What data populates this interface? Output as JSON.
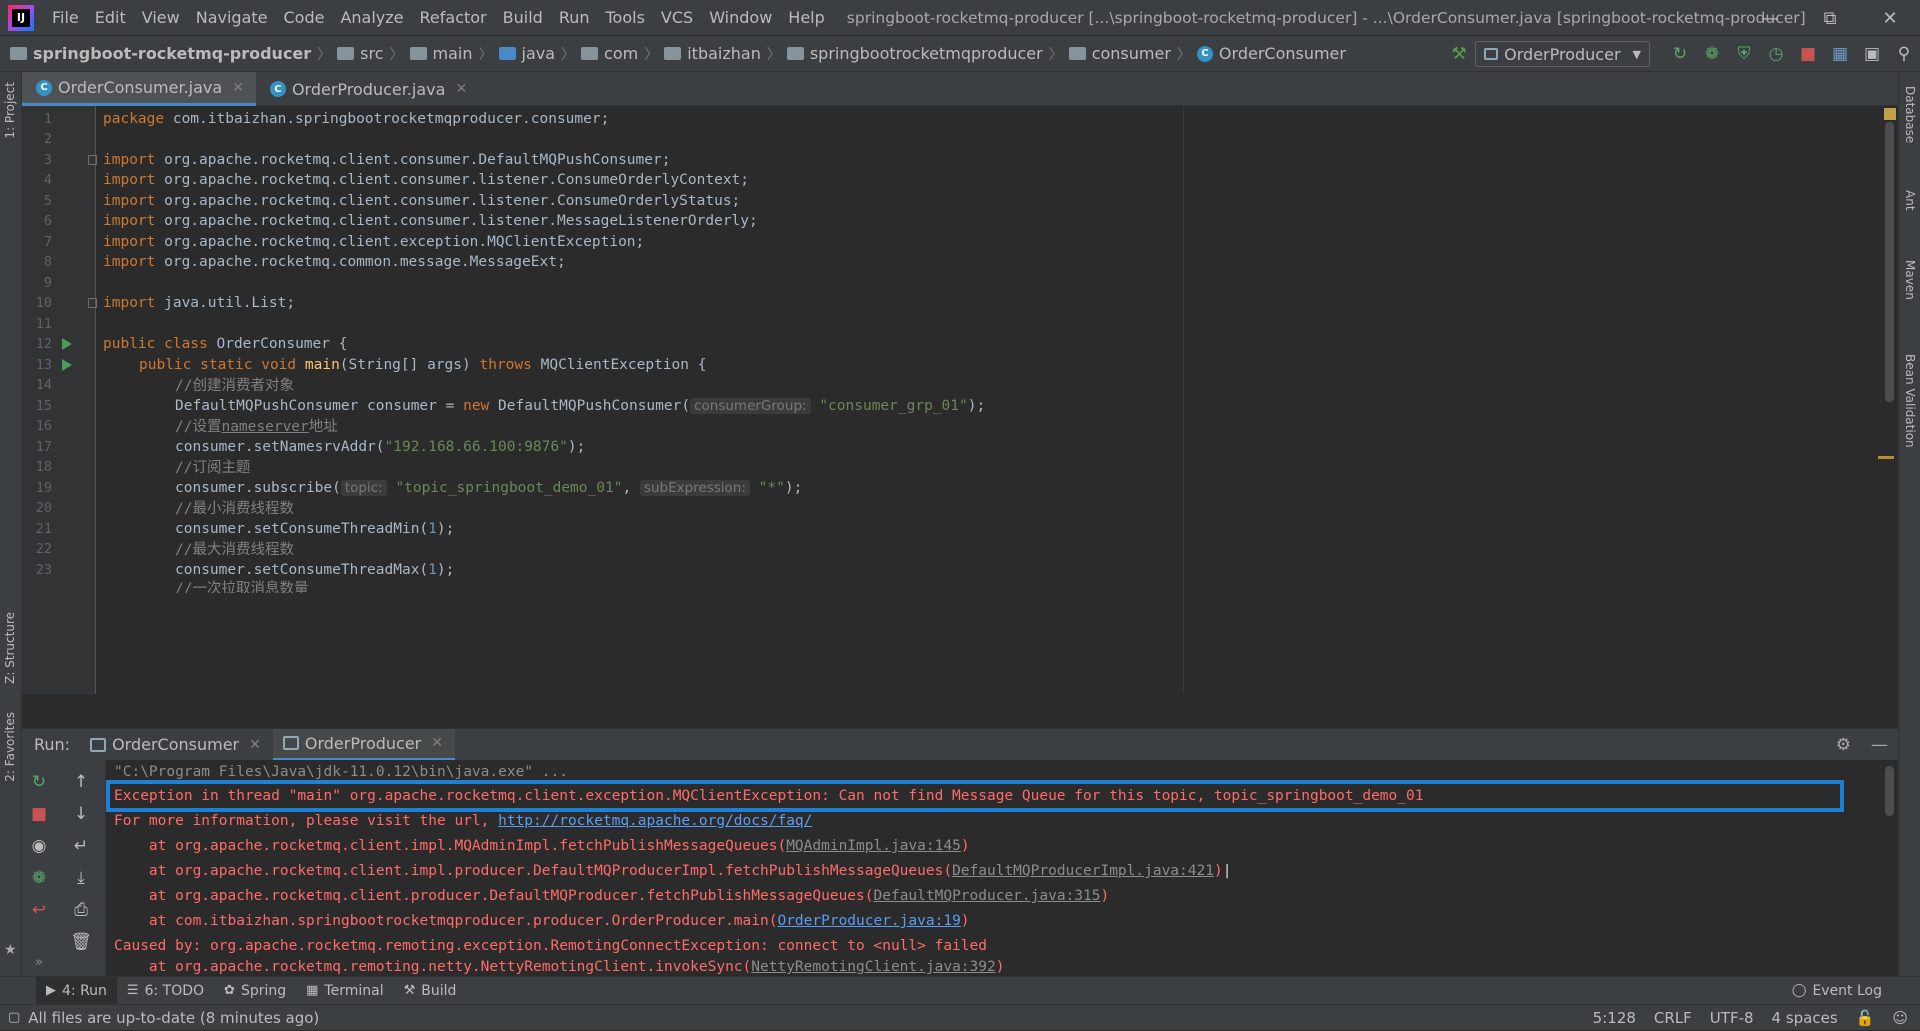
{
  "titlebar": {
    "menu": [
      "File",
      "Edit",
      "View",
      "Navigate",
      "Code",
      "Analyze",
      "Refactor",
      "Build",
      "Run",
      "Tools",
      "VCS",
      "Window",
      "Help"
    ],
    "window_title": "springboot-rocketmq-producer [...\\springboot-rocketmq-producer] - ...\\OrderConsumer.java [springboot-rocketmq-producer]"
  },
  "breadcrumb": {
    "project": "springboot-rocketmq-producer",
    "items": [
      "src",
      "main",
      "java",
      "com",
      "itbaizhan",
      "springbootrocketmqproducer",
      "consumer",
      "OrderConsumer"
    ]
  },
  "run_config": {
    "selected": "OrderProducer"
  },
  "left_stripe": {
    "project": "1: Project",
    "structure": "Z: Structure",
    "favorites": "2: Favorites"
  },
  "right_stripe": {
    "database": "Database",
    "ant": "Ant",
    "maven": "Maven",
    "bean": "Bean Validation"
  },
  "editor_tabs": [
    {
      "label": "OrderConsumer.java",
      "active": true
    },
    {
      "label": "OrderProducer.java",
      "active": false
    }
  ],
  "code": {
    "line_numbers": [
      "1",
      "2",
      "3",
      "4",
      "5",
      "6",
      "7",
      "8",
      "9",
      "10",
      "11",
      "12",
      "13",
      "14",
      "15",
      "16",
      "17",
      "18",
      "19",
      "20",
      "21",
      "22",
      "23"
    ],
    "l1_kw": "package",
    "l1_rest": " com.itbaizhan.springbootrocketmqproducer.consumer;",
    "import_kw": "import",
    "l3": " org.apache.rocketmq.client.consumer.DefaultMQPushConsumer;",
    "l4": " org.apache.rocketmq.client.consumer.listener.ConsumeOrderlyContext;",
    "l5": " org.apache.rocketmq.client.consumer.listener.ConsumeOrderlyStatus;",
    "l6": " org.apache.rocketmq.client.consumer.listener.MessageListenerOrderly;",
    "l7": " org.apache.rocketmq.client.exception.MQClientException;",
    "l8": " org.apache.rocketmq.common.message.MessageExt;",
    "l10": " java.util.List;",
    "l12_kw": "public class",
    "l12_rest": " OrderConsumer {",
    "l13_kw1": "public static void",
    "l13_fn": "main",
    "l13_mid": "(String[] args) ",
    "l13_kw2": "throws",
    "l13_rest": " MQClientException {",
    "l14": "//创建消费者对象",
    "l15_a": "DefaultMQPushConsumer consumer = ",
    "l15_kw": "new",
    "l15_b": " DefaultMQPushConsumer(",
    "l15_hint": "consumerGroup:",
    "l15_str": "\"consumer_grp_01\"",
    "l15_end": ");",
    "l16_a": "//设置",
    "l16_u": "nameserver",
    "l16_b": "地址",
    "l17_a": "consumer.setNamesrvAddr(",
    "l17_str": "\"192.168.66.100:9876\"",
    "l17_end": ");",
    "l18": "//订阅主题",
    "l19_a": "consumer.subscribe(",
    "l19_hint1": "topic:",
    "l19_str1": "\"topic_springboot_demo_01\"",
    "l19_comma": ", ",
    "l19_hint2": "subExpression:",
    "l19_str2": "\"*\"",
    "l19_end": ");",
    "l20": "//最小消费线程数",
    "l21_a": "consumer.setConsumeThreadMin(",
    "l21_num": "1",
    "l21_end": ");",
    "l22": "//最大消费线程数",
    "l23_a": "consumer.setConsumeThreadMax(",
    "l23_num": "1",
    "l23_end": ");",
    "l24": "//一次拉取消息数量"
  },
  "run_panel": {
    "label": "Run:",
    "tabs": [
      {
        "label": "OrderConsumer",
        "active": false
      },
      {
        "label": "OrderProducer",
        "active": true
      }
    ]
  },
  "console": {
    "cmd": "\"C:\\Program Files\\Java\\jdk-11.0.12\\bin\\java.exe\" ...",
    "exception": "Exception in thread \"main\" org.apache.rocketmq.client.exception.MQClientException: Can not find Message Queue for this topic, topic_springboot_demo_01",
    "more_info": "For more information, please visit the url, ",
    "url": "http://rocketmq.apache.org/docs/faq/",
    "st1_a": "    at org.apache.rocketmq.client.impl.MQAdminImpl.fetchPublishMessageQueues(",
    "st1_file": "MQAdminImpl.java:145",
    "st1_end": ")",
    "st2_a": "    at org.apache.rocketmq.client.impl.producer.DefaultMQProducerImpl.fetchPublishMessageQueues(",
    "st2_file": "DefaultMQProducerImpl.java:421",
    "st2_end": ")",
    "st3_a": "    at org.apache.rocketmq.client.producer.DefaultMQProducer.fetchPublishMessageQueues(",
    "st3_file": "DefaultMQProducer.java:315",
    "st3_end": ")",
    "st4_a": "    at com.itbaizhan.springbootrocketmqproducer.producer.OrderProducer.main(",
    "st4_file": "OrderProducer.java:19",
    "st4_end": ")",
    "caused": "Caused by: org.apache.rocketmq.remoting.exception.RemotingConnectException: connect to <null> failed",
    "st5_a": "    at org.apache.rocketmq.remoting.netty.NettyRemotingClient.invokeSync(",
    "st5_file": "NettyRemotingClient.java:392",
    "st5_end": ")"
  },
  "bottom_tools": [
    "4: Run",
    "6: TODO",
    "Spring",
    "Terminal",
    "Build"
  ],
  "event_log": "Event Log",
  "status": {
    "message": "All files are up-to-date (8 minutes ago)",
    "position": "5:128",
    "line_sep": "CRLF",
    "encoding": "UTF-8",
    "indent": "4 spaces"
  },
  "colors": {
    "highlight_box": "#1e7fd6",
    "error_text": "#ff6b68",
    "link": "#589df6"
  }
}
